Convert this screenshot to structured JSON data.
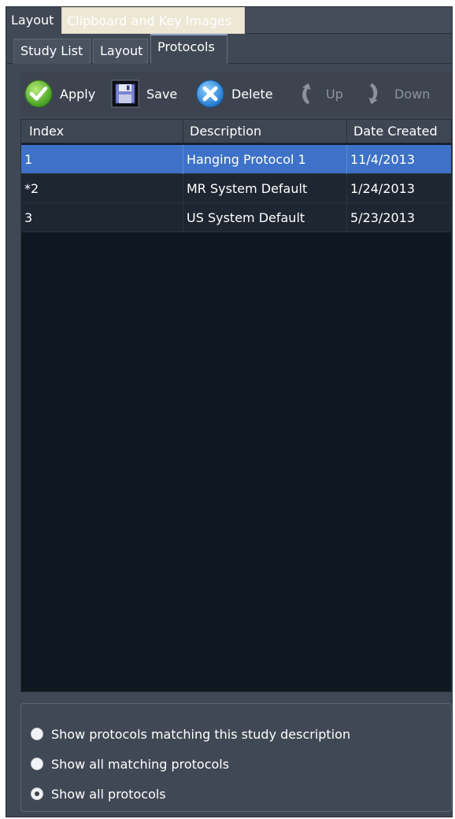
{
  "top_tabs": [
    {
      "label": "Layout",
      "active": true
    },
    {
      "label": "Clipboard and Key Images",
      "active": false
    }
  ],
  "sub_tabs": [
    {
      "label": "Study List"
    },
    {
      "label": "Layout"
    },
    {
      "label": "Protocols",
      "active": true
    }
  ],
  "toolbar": {
    "apply": "Apply",
    "save": "Save",
    "delete": "Delete",
    "up": "Up",
    "down": "Down"
  },
  "table": {
    "headers": [
      "Index",
      "Description",
      "Date Created"
    ],
    "rows": [
      {
        "index": "1",
        "description": "Hanging Protocol 1",
        "date": "11/4/2013",
        "selected": true
      },
      {
        "index": "*2",
        "description": "MR System Default",
        "date": "1/24/2013",
        "selected": false
      },
      {
        "index": "3",
        "description": "US System Default",
        "date": "5/23/2013",
        "selected": false
      }
    ]
  },
  "options": [
    {
      "label": "Show protocols matching this study description",
      "checked": false
    },
    {
      "label": "Show all matching protocols",
      "checked": false
    },
    {
      "label": "Show all protocols",
      "checked": true
    }
  ],
  "colors": {
    "selected_row": "#3d72c8",
    "panel": "#414855",
    "grid_background": "#0f1820"
  }
}
